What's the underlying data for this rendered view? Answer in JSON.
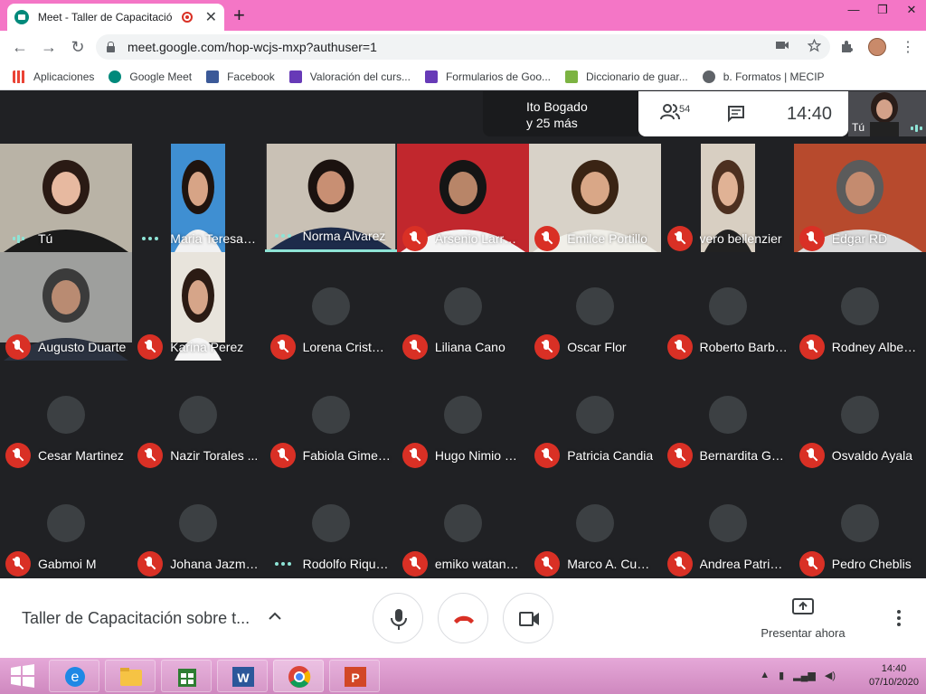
{
  "browser": {
    "tab_title": "Meet - Taller de Capacitación",
    "tab_close": "✕",
    "new_tab": "+",
    "url": "meet.google.com/hop-wcjs-mxp?authuser=1",
    "window_controls": [
      "—",
      "❐",
      "✕"
    ],
    "bookmarks": [
      {
        "label": "Aplicaciones",
        "icon": "apps-grid-icon"
      },
      {
        "label": "Google Meet",
        "icon": "meet-icon"
      },
      {
        "label": "Facebook",
        "icon": "facebook-icon"
      },
      {
        "label": "Valoración del curs...",
        "icon": "forms-icon"
      },
      {
        "label": "Formularios de Goo...",
        "icon": "forms-icon"
      },
      {
        "label": "Diccionario de guar...",
        "icon": "dictionary-icon"
      },
      {
        "label": "b. Formatos | MECIP",
        "icon": "globe-icon"
      }
    ]
  },
  "meet": {
    "presenter_line1": "Ito Bogado",
    "presenter_line2": "y 25 más",
    "participant_count": "54",
    "time": "14:40",
    "self_label": "Tú",
    "tiles": [
      {
        "name": "Tú",
        "status": "bars"
      },
      {
        "name": "Maria Teresa C...",
        "status": "dots"
      },
      {
        "name": "Norma Alvarez",
        "status": "dots"
      },
      {
        "name": "Arsenio Larrosa",
        "status": "muted"
      },
      {
        "name": "Emilce Portillo",
        "status": "muted"
      },
      {
        "name": "vero bellenzier",
        "status": "muted"
      },
      {
        "name": "Edgar RD",
        "status": "muted"
      },
      {
        "name": "Augusto Duarte",
        "status": "muted"
      },
      {
        "name": "Karina Perez",
        "status": "muted"
      },
      {
        "name": "Lorena Cristal...",
        "status": "muted"
      },
      {
        "name": "Liliana Cano",
        "status": "muted"
      },
      {
        "name": "Oscar Flor",
        "status": "muted"
      },
      {
        "name": "Roberto Barbo...",
        "status": "muted"
      },
      {
        "name": "Rodney Albert...",
        "status": "muted"
      },
      {
        "name": "Cesar Martinez",
        "status": "muted"
      },
      {
        "name": "Nazir Torales ...",
        "status": "muted"
      },
      {
        "name": "Fabiola Gimen...",
        "status": "muted"
      },
      {
        "name": "Hugo Nimio Or...",
        "status": "muted"
      },
      {
        "name": "Patricia Candia",
        "status": "muted"
      },
      {
        "name": "Bernardita Guil...",
        "status": "muted"
      },
      {
        "name": "Osvaldo Ayala",
        "status": "muted"
      },
      {
        "name": "Gabmoi M",
        "status": "muted"
      },
      {
        "name": "Johana Jazmi...",
        "status": "muted"
      },
      {
        "name": "Rodolfo Riquel...",
        "status": "dots"
      },
      {
        "name": "emiko watanabe",
        "status": "muted"
      },
      {
        "name": "Marco A. Cubil...",
        "status": "muted"
      },
      {
        "name": "Andrea Patrici...",
        "status": "muted"
      },
      {
        "name": "Pedro Cheblis",
        "status": "muted"
      }
    ]
  },
  "bottom": {
    "meeting_title": "Taller de Capacitación sobre t...",
    "present_label": "Presentar ahora"
  },
  "taskbar": {
    "time": "14:40",
    "date": "07/10/2020"
  },
  "colors": {
    "tabstrip": "#f476c6",
    "meet_bg": "#202124",
    "muted_red": "#d93025",
    "accent_teal": "#8ee4d6"
  }
}
